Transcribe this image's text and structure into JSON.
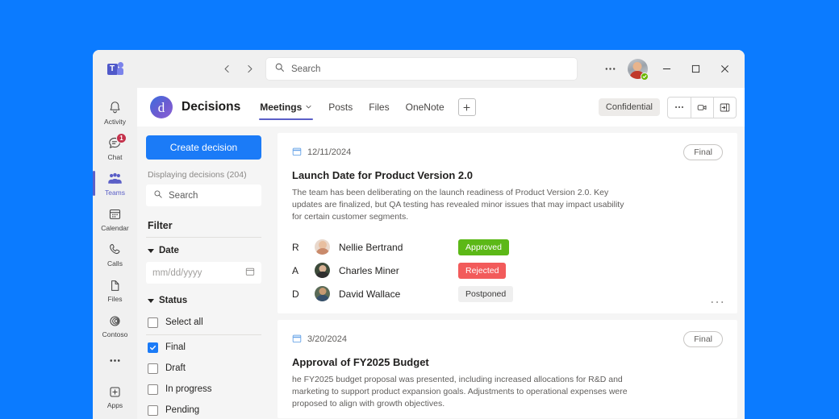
{
  "titlebar": {
    "logo_name": "microsoft-teams-logo",
    "logo_letter": "T",
    "back_icon": "chevron-left-icon",
    "forward_icon": "chevron-right-icon",
    "search": {
      "placeholder": "Search",
      "icon": "search-icon"
    },
    "more_icon": "more-horizontal-icon",
    "avatar_name": "user-avatar",
    "presence": "available",
    "minimize": "minimize-icon",
    "maximize": "maximize-icon",
    "close": "close-icon"
  },
  "rail": {
    "items": [
      {
        "label": "Activity",
        "icon": "bell-icon",
        "active": false,
        "badge": ""
      },
      {
        "label": "Chat",
        "icon": "chat-icon",
        "active": false,
        "badge": "1"
      },
      {
        "label": "Teams",
        "icon": "teams-people-icon",
        "active": true,
        "badge": ""
      },
      {
        "label": "Calendar",
        "icon": "calendar-icon",
        "active": false,
        "badge": ""
      },
      {
        "label": "Calls",
        "icon": "phone-icon",
        "active": false,
        "badge": ""
      },
      {
        "label": "Files",
        "icon": "file-icon",
        "active": false,
        "badge": ""
      },
      {
        "label": "Contoso",
        "icon": "contoso-rings-icon",
        "active": false,
        "badge": ""
      }
    ],
    "more_label": "",
    "more_icon": "more-horizontal-icon",
    "apps": {
      "label": "Apps",
      "icon": "plus-box-icon"
    }
  },
  "channel_header": {
    "team_avatar_letter": "d",
    "team_name": "Decisions",
    "tabs": [
      {
        "label": "Meetings",
        "active": true,
        "has_chevron": true
      },
      {
        "label": "Posts",
        "active": false,
        "has_chevron": false
      },
      {
        "label": "Files",
        "active": false,
        "has_chevron": false
      },
      {
        "label": "OneNote",
        "active": false,
        "has_chevron": false
      }
    ],
    "add_tab_icon": "plus-icon",
    "confidential_label": "Confidential",
    "actions": [
      {
        "icon": "more-horizontal-icon",
        "name": "more-options-button"
      },
      {
        "icon": "meet-now-icon",
        "name": "meet-now-button"
      },
      {
        "icon": "open-panel-icon",
        "name": "open-panel-button"
      }
    ]
  },
  "filters": {
    "create_button": "Create decision",
    "displaying_count": "Displaying decisions (204)",
    "search": {
      "placeholder": "Search",
      "icon": "search-icon"
    },
    "filter_title": "Filter",
    "date_section": {
      "label": "Date",
      "placeholder": "mm/dd/yyyy",
      "icon": "calendar-icon",
      "expanded": true
    },
    "status_section": {
      "label": "Status",
      "expanded": true,
      "options": [
        {
          "label": "Select all",
          "checked": false
        },
        {
          "label": "Final",
          "checked": true
        },
        {
          "label": "Draft",
          "checked": false
        },
        {
          "label": "In progress",
          "checked": false
        },
        {
          "label": "Pending",
          "checked": false
        }
      ]
    }
  },
  "decisions": [
    {
      "date": "12/11/2024",
      "date_icon": "calendar-icon",
      "status": "Final",
      "title": "Launch Date for Product Version 2.0",
      "description": "The team has been deliberating on the launch readiness of Product Version 2.0. Key updates are finalized, but QA testing has revealed minor issues that may impact usability for certain customer segments.",
      "people": [
        {
          "role": "R",
          "name": "Nellie Bertrand",
          "vote": "Approved",
          "vote_style": "approved"
        },
        {
          "role": "A",
          "name": "Charles Miner",
          "vote": "Rejected",
          "vote_style": "rejected"
        },
        {
          "role": "D",
          "name": "David Wallace",
          "vote": "Postponed",
          "vote_style": "postponed"
        }
      ],
      "more_icon": "more-horizontal-icon"
    },
    {
      "date": "3/20/2024",
      "date_icon": "calendar-icon",
      "status": "Final",
      "title": "Approval of FY2025 Budget",
      "description": "he FY2025 budget proposal was presented, including increased allocations for R&D and marketing to support product expansion goals. Adjustments to operational expenses were proposed to align with growth objectives.",
      "people": [],
      "more_icon": ""
    }
  ],
  "colors": {
    "desktop_background": "#0B7BFF",
    "accent_blue": "#1B7BF7",
    "teams_purple": "#5B5FC7",
    "approved_green": "#5CB817",
    "rejected_red": "#F25B5B",
    "postponed_gray": "#EFEFEF",
    "badge_red": "#C4314B",
    "presence_green": "#6BB700"
  }
}
